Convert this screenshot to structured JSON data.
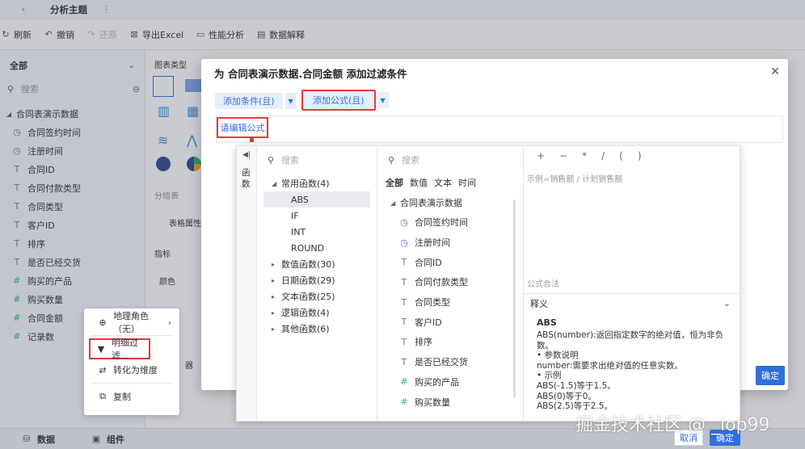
{
  "topbar": {
    "title": "分析主题"
  },
  "toolbar": {
    "items": [
      "刷新",
      "撤销",
      "还原",
      "导出Excel",
      "性能分析",
      "数据解释"
    ]
  },
  "left": {
    "dropdown": "全部",
    "search_placeholder": "搜索",
    "group": "合同表演示数据",
    "fields": [
      {
        "label": "合同签约时间",
        "icon": "clock"
      },
      {
        "label": "注册时间",
        "icon": "clock"
      },
      {
        "label": "合同ID",
        "icon": "text"
      },
      {
        "label": "合同付款类型",
        "icon": "text"
      },
      {
        "label": "合同类型",
        "icon": "text"
      },
      {
        "label": "客户ID",
        "icon": "text"
      },
      {
        "label": "排序",
        "icon": "text"
      },
      {
        "label": "是否已经交货",
        "icon": "text"
      },
      {
        "label": "购买的产品",
        "icon": "hash"
      },
      {
        "label": "购买数量",
        "icon": "hash"
      },
      {
        "label": "合同金额",
        "icon": "hash"
      },
      {
        "label": "记录数",
        "icon": "hash"
      }
    ]
  },
  "chart_cfg": {
    "type_label": "图表类型",
    "group_table": "分组表",
    "tab": "表格属性",
    "metric": "指标",
    "color": "颜色",
    "extra": "器"
  },
  "bottom": {
    "data_tab": "数据",
    "component_tab": "组件"
  },
  "context_menu": {
    "items": [
      "地理角色（无）",
      "明细过滤...",
      "转化为维度",
      "复制"
    ]
  },
  "dialog": {
    "title": "为 合同表演示数据.合同金额 添加过滤条件",
    "add_condition": "添加条件(且)",
    "add_formula": "添加公式(且)",
    "edit_formula_link": "请编辑公式",
    "confirm": "确定"
  },
  "editor": {
    "side_label": "函数",
    "search_placeholder": "搜索",
    "fn_groups": [
      {
        "label": "常用函数(4)",
        "expanded": true,
        "children": [
          "ABS",
          "IF",
          "INT",
          "ROUND"
        ]
      },
      {
        "label": "数值函数(30)"
      },
      {
        "label": "日期函数(29)"
      },
      {
        "label": "文本函数(25)"
      },
      {
        "label": "逻辑函数(4)"
      },
      {
        "label": "其他函数(6)"
      }
    ],
    "field_tabs": [
      "全部",
      "数值",
      "文本",
      "时间"
    ],
    "field_group": "合同表演示数据",
    "fields": [
      {
        "label": "合同签约时间",
        "icon": "clock"
      },
      {
        "label": "注册时间",
        "icon": "clock"
      },
      {
        "label": "合同ID",
        "icon": "text"
      },
      {
        "label": "合同付款类型",
        "icon": "text"
      },
      {
        "label": "合同类型",
        "icon": "text"
      },
      {
        "label": "客户ID",
        "icon": "text"
      },
      {
        "label": "排序",
        "icon": "text"
      },
      {
        "label": "是否已经交货",
        "icon": "text"
      },
      {
        "label": "购买的产品",
        "icon": "hash"
      },
      {
        "label": "购买数量",
        "icon": "hash"
      }
    ],
    "operators": [
      "+",
      "−",
      "*",
      "/",
      "(",
      ")"
    ],
    "formula_placeholder": "示例=销售额 / 计划销售额",
    "status": "公式合法",
    "explain_label": "释义",
    "fn_name": "ABS",
    "fn_desc": [
      "ABS(number):返回指定数字的绝对值，恒为非负数。",
      "• 参数说明",
      "number:需要求出绝对值的任意实数。",
      "• 示例",
      "ABS(-1.5)等于1.5。",
      "ABS(0)等于0。",
      "ABS(2.5)等于2.5。"
    ],
    "cancel": "取消",
    "confirm": "确定"
  },
  "watermark": "掘金技术社区 @ _iop99",
  "colors": {
    "accent": "#2f6fde",
    "highlight": "#e23b3b",
    "green": "#2fb27b"
  }
}
